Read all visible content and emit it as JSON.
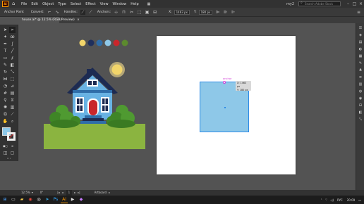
{
  "menubar": {
    "app_icon": "Ai",
    "items": [
      "File",
      "Edit",
      "Object",
      "Type",
      "Select",
      "Effect",
      "View",
      "Window",
      "Help"
    ],
    "workspace": "my2",
    "search_placeholder": "Search Adobe Stock"
  },
  "controlbar": {
    "selection": "Anchor Point",
    "convert_label": "Convert:",
    "handles_label": "Handles:",
    "anchors_label": "Anchors:",
    "x_label": "X:",
    "x_value": "1463 px",
    "y_label": "Y:",
    "y_value": "180 px"
  },
  "document": {
    "tab_title": "house.ai* @ 12.5% (RGB/Preview)"
  },
  "canvas": {
    "anchor_label": "anchor",
    "tooltip_x": "X: 1463 px",
    "tooltip_y": "Y: 180 px"
  },
  "palette": {
    "swatches": [
      "#f2d56a",
      "#1f2f5c",
      "#2f6da8",
      "#8ec8e8",
      "#c9262b",
      "#5c8a2e"
    ]
  },
  "house_colors": {
    "roof": "#1d2b52",
    "walls": "#68b2e3",
    "door": "#c9262b",
    "steps": "#2f6da8",
    "grass": "#8bb440",
    "bushes": "#4f9a31",
    "sun": "#f2d56a"
  },
  "status": {
    "zoom": "12.5%",
    "rotation": "0°",
    "artboard": "1",
    "tool_name": "Artboard"
  },
  "taskbar": {
    "lang": "РУС",
    "time": "20:09"
  }
}
